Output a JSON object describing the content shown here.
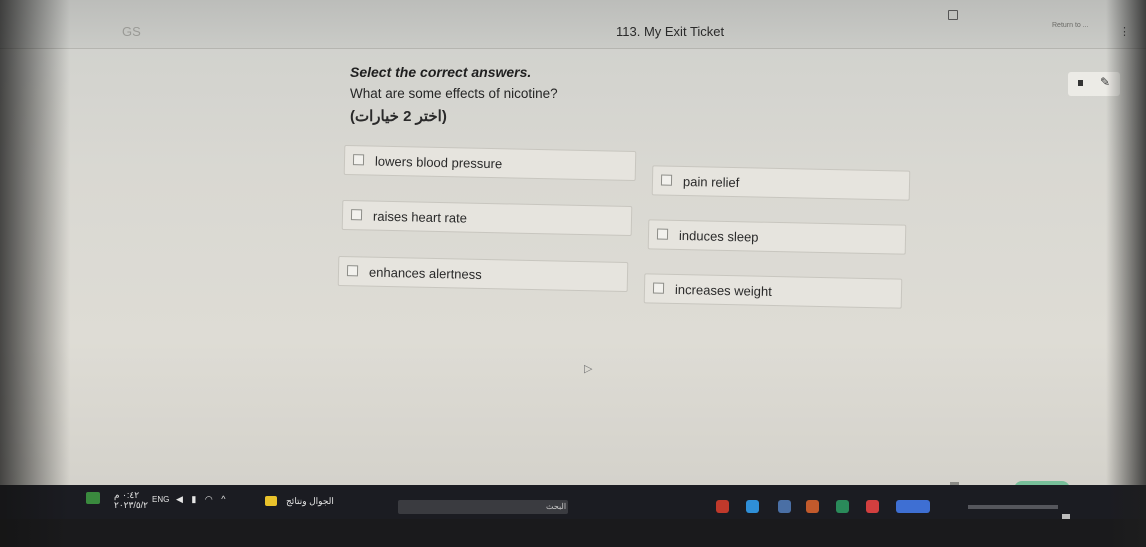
{
  "header": {
    "title": "113. My Exit Ticket",
    "logo": "GS",
    "right_link": "Return to ...",
    "kebab": "⋮"
  },
  "tools": {
    "icons": [
      "stop-square-icon",
      "pen-icon"
    ]
  },
  "question": {
    "instruction": "Select the correct answers.",
    "prompt": "What are some effects of nicotine?",
    "note_arabic": "(اختر 2 خيارات)",
    "options": [
      {
        "label": "lowers blood pressure",
        "checked": false
      },
      {
        "label": "raises heart rate",
        "checked": false
      },
      {
        "label": "enhances alertness",
        "checked": false
      },
      {
        "label": "pain relief",
        "checked": false
      },
      {
        "label": "induces sleep",
        "checked": false
      },
      {
        "label": "increases weight",
        "checked": false
      }
    ]
  },
  "colors": {
    "accent_green": "#5ab88a",
    "taskbar": "#1b1c22",
    "page": "#dedcd5"
  },
  "taskbar": {
    "time": "٠:٤٢ م",
    "date": "٢٠٢٣/٥/٢",
    "lang": "ENG",
    "news": "الجوال ونتائج",
    "search_label": "البحث"
  }
}
